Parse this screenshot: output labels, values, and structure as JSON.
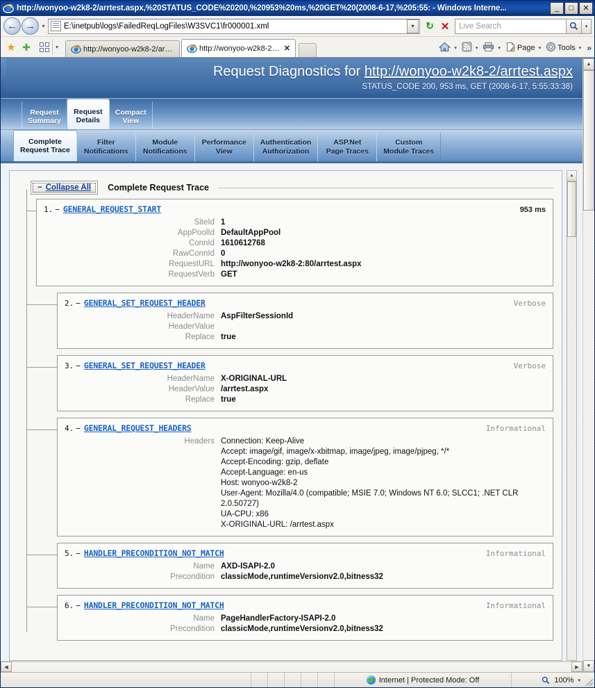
{
  "window": {
    "title": "http://wonyoo-w2k8-2/arrtest.aspx,%20STATUS_CODE%20200,%20953%20ms,%20GET%20(2008-6-17,%205:55: - Windows Interne...",
    "minimize_label": "_",
    "maximize_label": "□",
    "close_label": "✕"
  },
  "addressbar": {
    "back_label": "←",
    "forward_label": "→",
    "history_dropdown_label": "▾",
    "url": "E:\\inetpub\\logs\\FailedReqLogFiles\\W3SVC1\\fr000001.xml",
    "url_dropdown_label": "▾",
    "refresh_label": "↻",
    "stop_label": "✕",
    "search_placeholder": "Live Search",
    "search_value": "",
    "search_go_label": "⌕",
    "search_dropdown_label": "▾"
  },
  "toolbar": {
    "favorites_star_label": "★",
    "add_favorite_label": "✚",
    "quick_tabs_dropdown_label": "▾",
    "tabs": [
      {
        "label": "http://wonyoo-w2k8-2/arrte...",
        "active": false,
        "closable": false
      },
      {
        "label": "http://wonyoo-w2k8-2/a...",
        "active": true,
        "closable": true,
        "close_label": "✕"
      }
    ],
    "commands": [
      {
        "name": "home",
        "label": "",
        "icon": "home-icon",
        "arrow": "▾"
      },
      {
        "name": "feeds",
        "label": "",
        "icon": "rss-icon",
        "arrow": "▾"
      },
      {
        "name": "print",
        "label": "",
        "icon": "printer-icon",
        "arrow": "▾"
      },
      {
        "name": "page",
        "label": "Page",
        "icon": "page-icon",
        "arrow": "▾"
      },
      {
        "name": "tools",
        "label": "Tools",
        "icon": "gear-icon",
        "arrow": "▾"
      }
    ],
    "overflow_label": "»"
  },
  "report": {
    "banner": {
      "title_prefix": "Request Diagnostics for ",
      "title_url": "http://wonyoo-w2k8-2/arrtest.aspx",
      "subtitle": "STATUS_CODE 200, 953 ms, GET (2008-6-17, 5:55:33:38)"
    },
    "primary_tabs": [
      {
        "line1": "Request",
        "line2": "Summary",
        "active": false
      },
      {
        "line1": "Request",
        "line2": "Details",
        "active": true
      },
      {
        "line1": "Compact",
        "line2": "View",
        "active": false
      }
    ],
    "secondary_tabs": [
      {
        "line1": "Complete",
        "line2": "Request Trace",
        "active": true
      },
      {
        "line1": "Filter",
        "line2": "Notifications",
        "active": false
      },
      {
        "line1": "Module",
        "line2": "Notifications",
        "active": false
      },
      {
        "line1": "Performance",
        "line2": "View",
        "active": false
      },
      {
        "line1": "Authentication",
        "line2": "Authorization",
        "active": false
      },
      {
        "line1": "ASP.Net",
        "line2": "Page Traces",
        "active": false
      },
      {
        "line1": "Custom",
        "line2": "Module Traces",
        "active": false
      }
    ],
    "collapse_all": {
      "minus": "−",
      "label": "Collapse All"
    },
    "section_title": "Complete Request Trace",
    "entries": [
      {
        "num": "1.",
        "toggle": "−",
        "name": "GENERAL_REQUEST_START",
        "right": "953 ms",
        "right_kind": "ms",
        "level": 1,
        "fields": [
          {
            "key": "SiteId",
            "value": "1"
          },
          {
            "key": "AppPoolId",
            "value": "DefaultAppPool"
          },
          {
            "key": "ConnId",
            "value": "1610612768"
          },
          {
            "key": "RawConnId",
            "value": "0"
          },
          {
            "key": "RequestURL",
            "value": "http://wonyoo-w2k8-2:80/arrtest.aspx"
          },
          {
            "key": "RequestVerb",
            "value": "GET"
          }
        ]
      },
      {
        "num": "2.",
        "toggle": "−",
        "name": "GENERAL_SET_REQUEST_HEADER",
        "right": "Verbose",
        "right_kind": "level",
        "level": 2,
        "fields": [
          {
            "key": "HeaderName",
            "value": "AspFilterSessionId"
          },
          {
            "key": "HeaderValue",
            "value": ""
          },
          {
            "key": "Replace",
            "value": "true"
          }
        ]
      },
      {
        "num": "3.",
        "toggle": "−",
        "name": "GENERAL_SET_REQUEST_HEADER",
        "right": "Verbose",
        "right_kind": "level",
        "level": 2,
        "fields": [
          {
            "key": "HeaderName",
            "value": "X-ORIGINAL-URL"
          },
          {
            "key": "HeaderValue",
            "value": "/arrtest.aspx"
          },
          {
            "key": "Replace",
            "value": "true"
          }
        ]
      },
      {
        "num": "4.",
        "toggle": "−",
        "name": "GENERAL_REQUEST_HEADERS",
        "right": "Informational",
        "right_kind": "level",
        "level": 2,
        "fields": [
          {
            "key": "Headers",
            "multiline": [
              "Connection: Keep-Alive",
              "Accept: image/gif, image/x-xbitmap, image/jpeg, image/pjpeg, */*",
              "Accept-Encoding: gzip, deflate",
              "Accept-Language: en-us",
              "Host: wonyoo-w2k8-2",
              "User-Agent: Mozilla/4.0 (compatible; MSIE 7.0; Windows NT 6.0; SLCC1; .NET CLR 2.0.50727)",
              "UA-CPU: x86",
              "X-ORIGINAL-URL: /arrtest.aspx"
            ]
          }
        ]
      },
      {
        "num": "5.",
        "toggle": "−",
        "name": "HANDLER_PRECONDITION_NOT_MATCH",
        "right": "Informational",
        "right_kind": "level",
        "level": 2,
        "fields": [
          {
            "key": "Name",
            "value": "AXD-ISAPI-2.0"
          },
          {
            "key": "Precondition",
            "value": "classicMode,runtimeVersionv2.0,bitness32"
          }
        ]
      },
      {
        "num": "6.",
        "toggle": "−",
        "name": "HANDLER_PRECONDITION_NOT_MATCH",
        "right": "Informational",
        "right_kind": "level",
        "level": 2,
        "fields": [
          {
            "key": "Name",
            "value": "PageHandlerFactory-ISAPI-2.0"
          },
          {
            "key": "Precondition",
            "value": "classicMode,runtimeVersionv2.0,bitness32"
          }
        ]
      }
    ]
  },
  "scrollbars": {
    "up_arrow": "▲",
    "down_arrow": "▼",
    "left_arrow": "◀",
    "right_arrow": "▶"
  },
  "statusbar": {
    "message": "",
    "zone": "Internet | Protected Mode: Off",
    "zoom": "100%",
    "zoom_dropdown_label": "▾"
  }
}
